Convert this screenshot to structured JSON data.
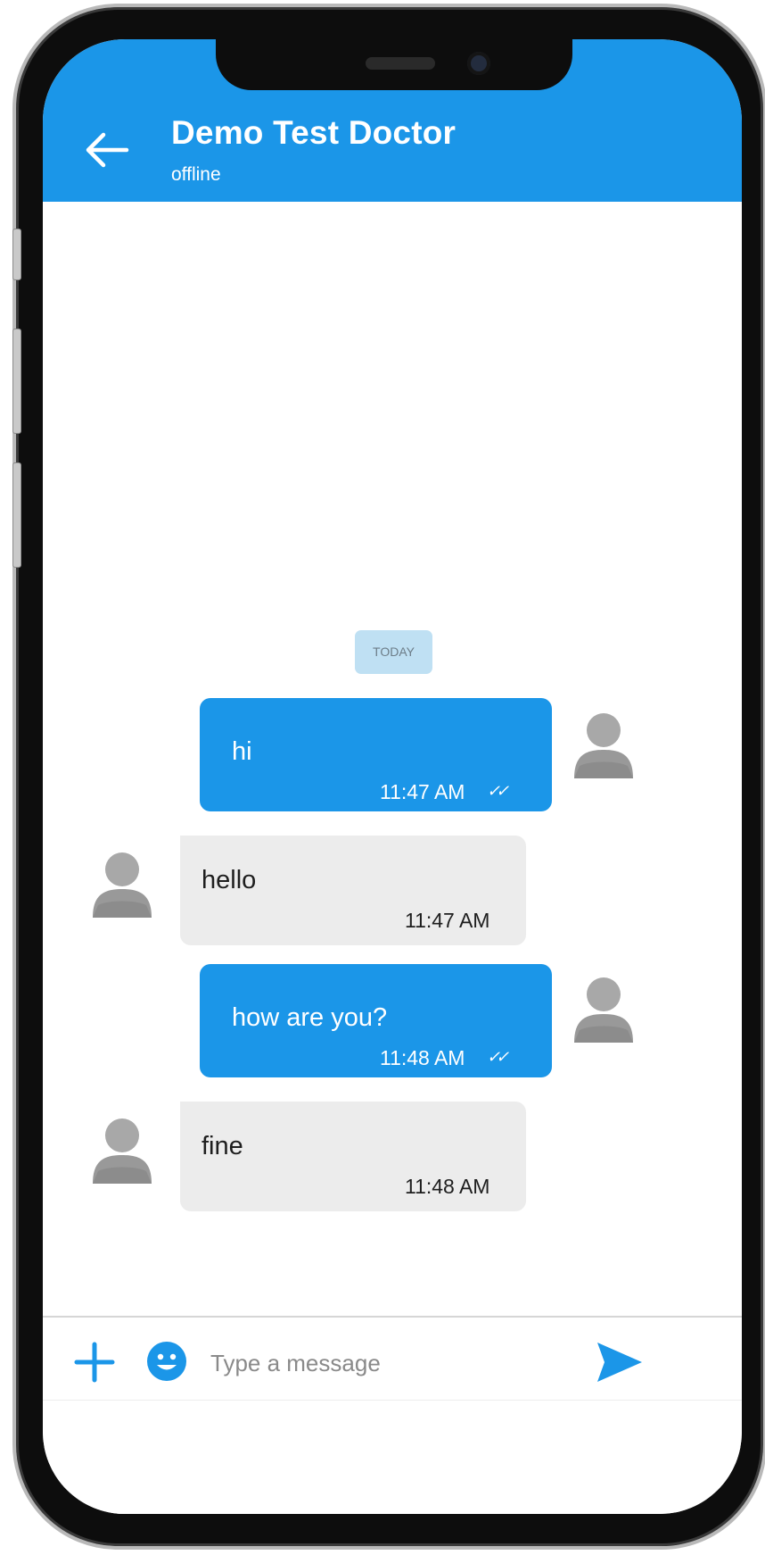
{
  "header": {
    "title": "Demo Test Doctor",
    "status": "offline",
    "color": "#1b96e8"
  },
  "chat": {
    "date_separator": "TODAY",
    "messages": [
      {
        "direction": "outgoing",
        "text": "hi",
        "time": "11:47 AM",
        "read_receipt": "double-check-icon"
      },
      {
        "direction": "incoming",
        "text": "hello",
        "time": "11:47 AM"
      },
      {
        "direction": "outgoing",
        "text": "how are you?",
        "time": "11:48 AM",
        "read_receipt": "double-check-icon"
      },
      {
        "direction": "incoming",
        "text": "fine",
        "time": "11:48 AM"
      }
    ]
  },
  "composer": {
    "placeholder": "Type a message",
    "attach_icon": "plus-icon",
    "emoji_icon": "emoji-icon",
    "send_icon": "send-icon"
  },
  "colors": {
    "outgoing_bubble": "#1b96e8",
    "incoming_bubble": "#ececec",
    "date_chip": "#bfe0f3"
  }
}
